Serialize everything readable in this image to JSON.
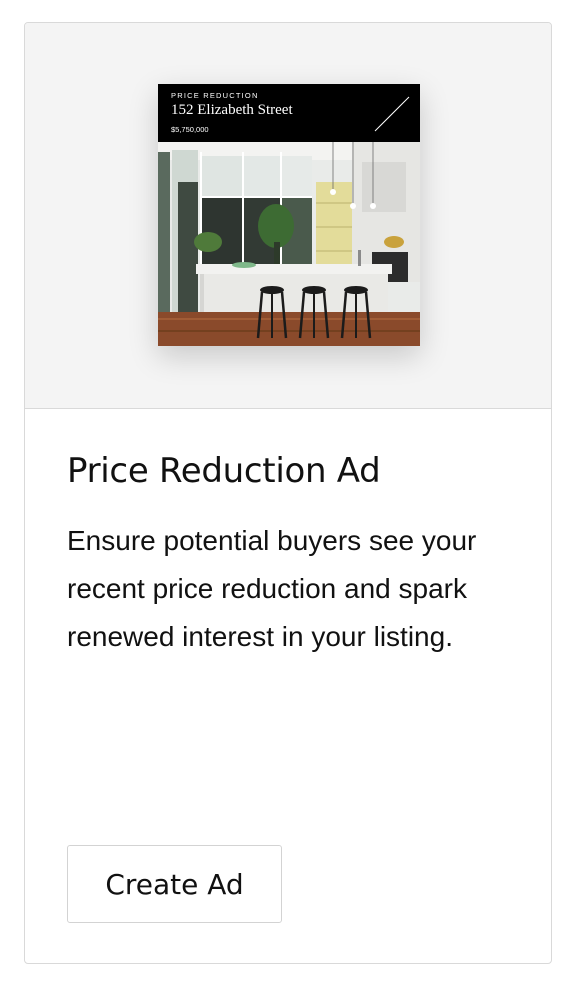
{
  "card": {
    "title": "Price Reduction Ad",
    "description": "Ensure potential buyers see your recent price reduction and spark renewed interest in your listing.",
    "button_label": "Create Ad"
  },
  "ad_preview": {
    "kicker": "PRICE REDUCTION",
    "address": "152 Elizabeth Street",
    "price": "$5,750,000",
    "image": "kitchen-interior-photo"
  },
  "colors": {
    "banner": "#000000",
    "preview_bg": "#f4f4f4",
    "border": "#d9d9d9"
  }
}
